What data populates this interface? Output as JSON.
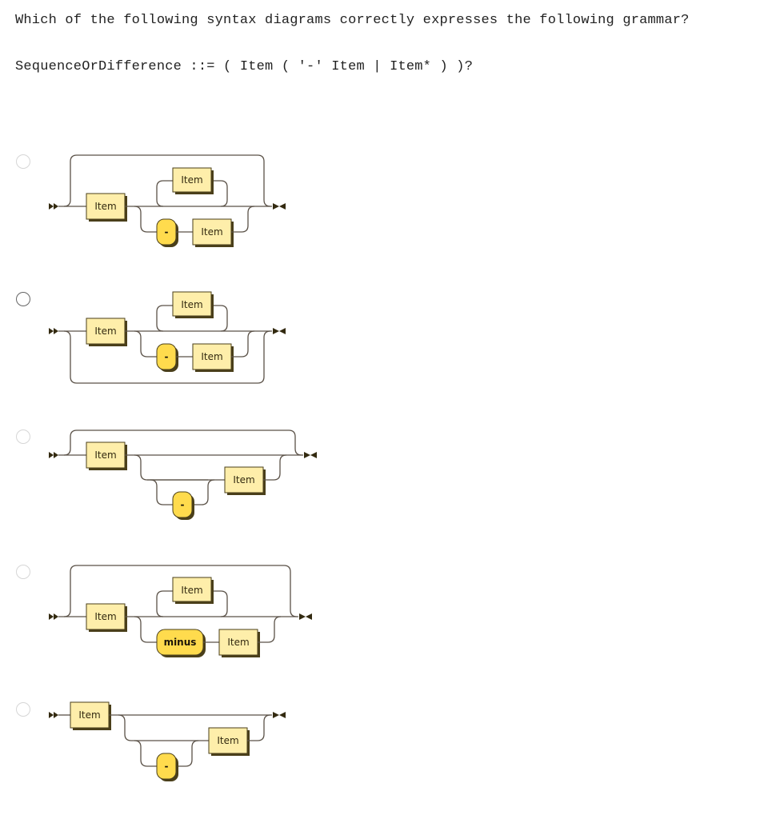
{
  "question": {
    "prompt": "Which of the following syntax diagrams correctly expresses the following grammar?",
    "grammar": "SequenceOrDifference ::= ( Item ( '-' Item | Item* ) )?"
  },
  "options": [
    {
      "selected": false,
      "description": "Optional bypass above; Item then choice of (Item* loop above) or ('-' Item)",
      "labels": {
        "first_item": "Item",
        "loop_item": "Item",
        "terminal": "-",
        "after_terminal_item": "Item"
      }
    },
    {
      "selected": false,
      "description": "Optional bypass below; Item then choice of (Item* loop) or ('-' Item)",
      "labels": {
        "first_item": "Item",
        "loop_item": "Item",
        "terminal": "-",
        "after_terminal_item": "Item"
      }
    },
    {
      "selected": false,
      "description": "Optional bypass above; Item then optional ('-'?) Item",
      "labels": {
        "first_item": "Item",
        "terminal": "-",
        "after_terminal_item": "Item"
      }
    },
    {
      "selected": false,
      "description": "Optional bypass above; Item then choice of (Item* loop) or (minus Item)",
      "labels": {
        "first_item": "Item",
        "loop_item": "Item",
        "terminal": "minus",
        "after_terminal_item": "Item"
      }
    },
    {
      "selected": false,
      "description": "Item then optional ('-'? Item)",
      "labels": {
        "first_item": "Item",
        "terminal": "-",
        "after_terminal_item": "Item"
      }
    }
  ]
}
